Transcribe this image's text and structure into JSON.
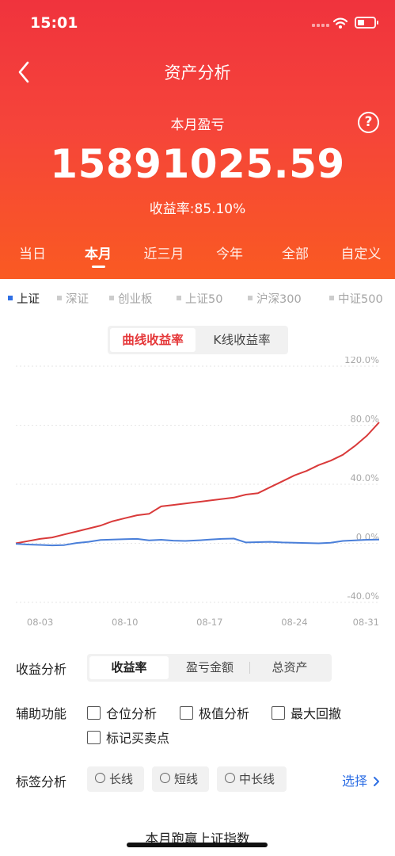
{
  "status_bar": {
    "time": "15:01"
  },
  "nav": {
    "title": "资产分析"
  },
  "summary": {
    "label": "本月盈亏",
    "amount": "15891025.59",
    "rate": "收益率:85.10%"
  },
  "period_tabs": [
    "当日",
    "本月",
    "近三月",
    "今年",
    "全部",
    "自定义"
  ],
  "active_period": "本月",
  "index_tabs": [
    "上证",
    "深证",
    "创业板",
    "上证50",
    "沪深300",
    "中证500"
  ],
  "active_index": "上证",
  "chart_mode": {
    "options": [
      "曲线收益率",
      "K线收益率"
    ],
    "active": "曲线收益率"
  },
  "chart_data": {
    "type": "line",
    "x": [
      "08-01",
      "08-02",
      "08-03",
      "08-04",
      "08-05",
      "08-06",
      "08-07",
      "08-08",
      "08-09",
      "08-10",
      "08-11",
      "08-12",
      "08-13",
      "08-14",
      "08-15",
      "08-16",
      "08-17",
      "08-18",
      "08-19",
      "08-20",
      "08-21",
      "08-22",
      "08-23",
      "08-24",
      "08-25",
      "08-26",
      "08-27",
      "08-28",
      "08-29",
      "08-30",
      "08-31"
    ],
    "x_ticks": [
      "08-03",
      "08-10",
      "08-17",
      "08-24",
      "08-31"
    ],
    "y_ticks": [
      "120.0%",
      "80.0%",
      "40.0%",
      "0.0%",
      "-40.0%"
    ],
    "ylim": [
      -40,
      120
    ],
    "grid": true,
    "series": [
      {
        "color": "#d93a3a",
        "values": [
          0,
          1.5,
          3,
          4,
          6,
          8,
          10,
          12,
          15,
          17,
          19,
          20,
          25,
          26,
          27,
          28,
          29,
          30,
          31,
          33,
          34,
          38,
          42,
          46,
          49,
          53,
          56,
          60,
          66,
          73,
          82
        ]
      },
      {
        "color": "#4a7fd9",
        "values": [
          -0.3,
          -0.8,
          -1.1,
          -1.4,
          -1.2,
          0.2,
          1.0,
          2.3,
          2.6,
          2.8,
          3.0,
          2.0,
          2.4,
          1.8,
          1.6,
          2.0,
          2.5,
          3.0,
          3.2,
          0.6,
          0.8,
          1.0,
          0.6,
          0.4,
          0.2,
          0.0,
          0.4,
          1.6,
          2.0,
          2.4,
          2.6
        ]
      }
    ]
  },
  "analysis": {
    "label": "收益分析",
    "options": [
      "收益率",
      "盈亏金额",
      "总资产"
    ],
    "active": "收益率"
  },
  "aux": {
    "label": "辅助功能",
    "options": [
      "仓位分析",
      "极值分析",
      "最大回撤",
      "标记买卖点"
    ]
  },
  "tags": {
    "label": "标签分析",
    "options": [
      "长线",
      "短线",
      "中长线"
    ],
    "select_label": "选择"
  },
  "footer": {
    "title": "本月跑赢上证指数"
  },
  "colors": {
    "header_top": "#f0333d",
    "header_bottom": "#fa5a22",
    "accent_red": "#e5383a",
    "accent_blue": "#2f6fe4"
  },
  "icons": [
    "back-icon",
    "help-icon",
    "wifi-icon",
    "battery-icon",
    "chevron-right-icon"
  ]
}
